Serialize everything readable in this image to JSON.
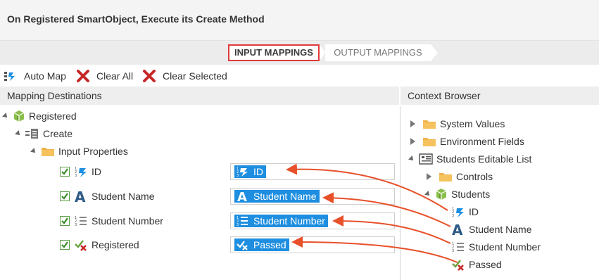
{
  "header": {
    "title": "On Registered SmartObject, Execute its Create Method"
  },
  "wizard": {
    "steps": [
      {
        "label": "INPUT MAPPINGS",
        "active": true
      },
      {
        "label": "OUTPUT MAPPINGS",
        "active": false
      }
    ]
  },
  "toolbar": {
    "auto_map": "Auto Map",
    "clear_all": "Clear All",
    "clear_selected": "Clear Selected"
  },
  "mapping_destinations": {
    "title": "Mapping Destinations",
    "tree": {
      "root": "Registered",
      "method": "Create",
      "input_properties": "Input Properties"
    },
    "fields": [
      {
        "label": "ID",
        "checked": true,
        "icon": "number-icon",
        "mapped": "ID"
      },
      {
        "label": "Student Name",
        "checked": true,
        "icon": "text-icon",
        "mapped": "Student Name"
      },
      {
        "label": "Student Number",
        "checked": true,
        "icon": "list-number-icon",
        "mapped": "Student Number"
      },
      {
        "label": "Registered",
        "checked": true,
        "icon": "yesno-icon",
        "mapped": "Passed"
      }
    ]
  },
  "context_browser": {
    "title": "Context Browser",
    "system_values": "System Values",
    "environment_fields": "Environment Fields",
    "students_list": "Students Editable List",
    "controls": "Controls",
    "students": "Students",
    "fields": [
      "ID",
      "Student Name",
      "Student Number",
      "Passed"
    ]
  },
  "colors": {
    "accent": "#1e8ee0",
    "highlight_border": "#e03b3b",
    "arrow": "#e8502a",
    "folder": "#f0b24a",
    "cube": "#8bbf4b"
  }
}
